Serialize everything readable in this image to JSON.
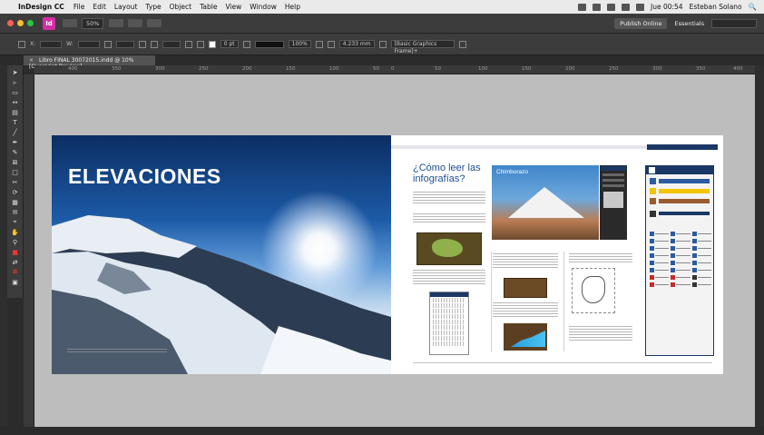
{
  "menubar": {
    "app": "InDesign CC",
    "items": [
      "File",
      "Edit",
      "Layout",
      "Type",
      "Object",
      "Table",
      "View",
      "Window",
      "Help"
    ],
    "clock": "Jue 00:54",
    "user": "Esteban Solano"
  },
  "appbar": {
    "logo": "Id",
    "zoom": "50%",
    "publish_label": "Publish Online",
    "workspace": "Essentials"
  },
  "control_panel": {
    "stroke_weight": "0 pt",
    "percent": "100%",
    "dimension": "4.233 mm",
    "frame_style": "[Basic Graphics Frame]+"
  },
  "document_tab": {
    "title": "Libro FINAL 30072015.indd @ 10% [Overprint Preview]"
  },
  "ruler": {
    "labels": [
      "400",
      "350",
      "300",
      "250",
      "200",
      "150",
      "100",
      "50",
      "0",
      "50",
      "100",
      "150",
      "200",
      "250",
      "300",
      "350",
      "400"
    ]
  },
  "spread": {
    "left_title": "ELEVACIONES",
    "right_heading": "¿Cómo leer las infografías?",
    "photo_label": "Chimborazo"
  },
  "icons": {
    "apple": "apple-icon",
    "search": "search-icon"
  },
  "colors": {
    "accent_blue": "#1b3766",
    "indesign_pink": "#d32ea3"
  }
}
